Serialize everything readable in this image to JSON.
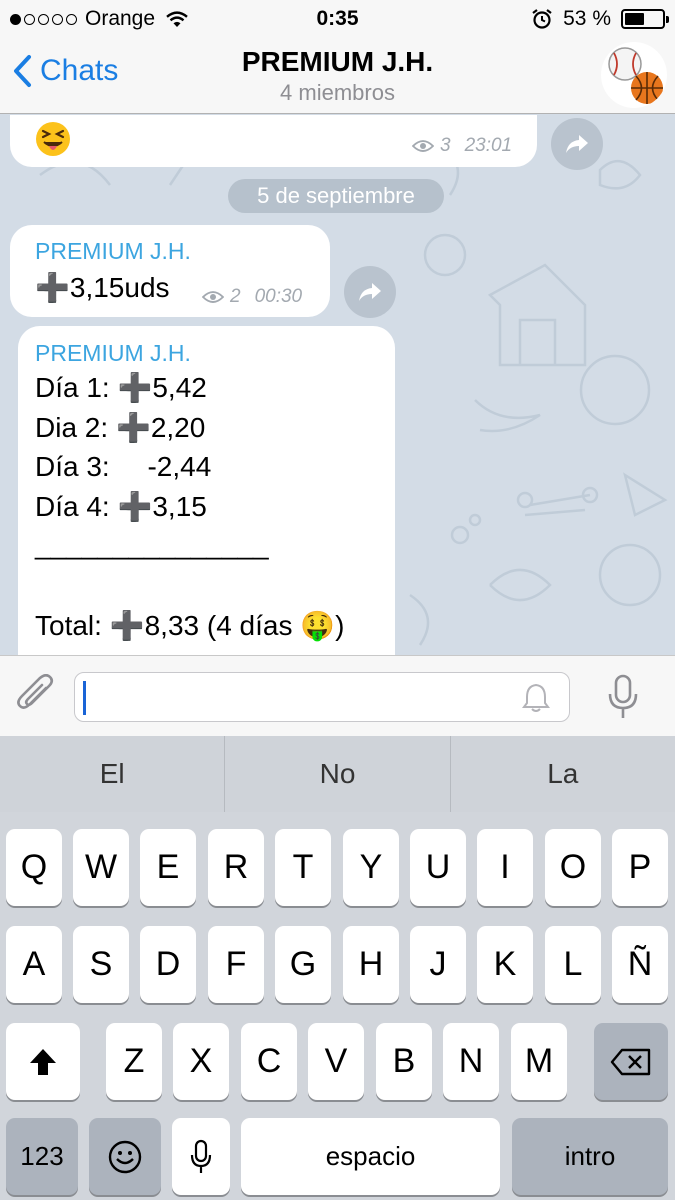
{
  "status_bar": {
    "carrier": "Orange",
    "time": "0:35",
    "battery": "53 %",
    "battery_level": 0.53
  },
  "nav": {
    "back_label": "Chats",
    "title": "PREMIUM J.H.",
    "subtitle": "4 miembros"
  },
  "chat": {
    "prev_message": {
      "views": "3",
      "time": "23:01"
    },
    "date_separator": "5 de septiembre",
    "messages": [
      {
        "sender": "PREMIUM J.H.",
        "lines": [
          {
            "plus": "➕",
            "text": "3,15uds"
          }
        ],
        "views": "2",
        "time": "00:30"
      },
      {
        "sender": "PREMIUM J.H.",
        "lines": [
          {
            "label": "Día 1:",
            "plus": "➕",
            "text": "5,42"
          },
          {
            "label": "Dia 2:",
            "plus": "➕",
            "text": "2,20"
          },
          {
            "label": "Día 3:",
            "plus": "",
            "text": "-2,44"
          },
          {
            "label": "Día 4:",
            "plus": "➕",
            "text": "3,15"
          },
          {
            "label": "_______________",
            "plus": "",
            "text": ""
          },
          {
            "label": "Total:",
            "plus": "➕",
            "text": "8,33 (4 días 🤑)"
          }
        ]
      }
    ]
  },
  "composer": {
    "placeholder": ""
  },
  "suggestions": [
    "El",
    "No",
    "La"
  ],
  "keyboard": {
    "row1": [
      "Q",
      "W",
      "E",
      "R",
      "T",
      "Y",
      "U",
      "I",
      "O",
      "P"
    ],
    "row2": [
      "A",
      "S",
      "D",
      "F",
      "G",
      "H",
      "J",
      "K",
      "L",
      "Ñ"
    ],
    "row3": [
      "Z",
      "X",
      "C",
      "V",
      "B",
      "N",
      "M"
    ],
    "numbers_key": "123",
    "space_key": "espacio",
    "return_key": "intro"
  }
}
